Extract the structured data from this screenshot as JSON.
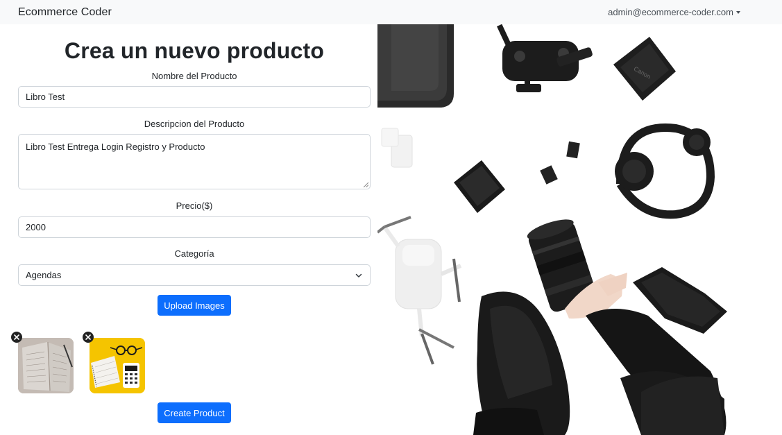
{
  "navbar": {
    "brand": "Ecommerce Coder",
    "user_email": "admin@ecommerce-coder.com"
  },
  "form": {
    "title": "Crea un nuevo producto",
    "name_label": "Nombre del Producto",
    "name_value": "Libro Test",
    "description_label": "Descripcion del Producto",
    "description_value": "Libro Test Entrega Login Registro y Producto",
    "price_label": "Precio($)",
    "price_value": "2000",
    "category_label": "Categoría",
    "category_value": "Agendas",
    "upload_button": "Upload Images",
    "create_button": "Create Product"
  },
  "uploaded_images": [
    {
      "name": "open-notebook-planner-image"
    },
    {
      "name": "notebook-glasses-calculator-yellow-image"
    }
  ],
  "colors": {
    "primary": "#0d6efd",
    "navbar_bg": "#f8f9fa",
    "border": "#ced4da",
    "yellow_bg": "#f5c400"
  }
}
